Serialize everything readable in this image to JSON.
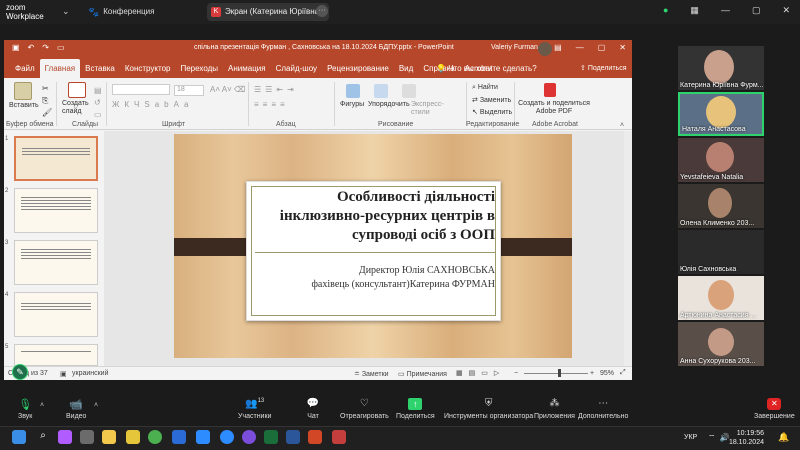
{
  "zoom": {
    "logo_line1": "zoom",
    "logo_line2": "Workplace",
    "tab_conference": "Конференция",
    "tab_screen": "Экран (Катерина Юріївна Фурм",
    "tab_screen_badge": "K",
    "ellipsis": "···"
  },
  "ppt": {
    "window_title": "спільна презентація Фурман , Сахновська на 18.10.2024 БДПУ.pptx  -  PowerPoint",
    "user": "Valeriy Furman",
    "tabs": [
      "Файл",
      "Главная",
      "Вставка",
      "Конструктор",
      "Переходы",
      "Анимация",
      "Слайд-шоу",
      "Рецензирование",
      "Вид",
      "Справка",
      "Acrobat"
    ],
    "active_tab": "Главная",
    "tell_me": "Что вы хотите сделать?",
    "share": "Поделиться",
    "ribbon": {
      "paste": "Вставить",
      "create_slide": "Создать слайд",
      "figures": "Фигуры",
      "arrange": "Упорядочить",
      "express_styles": "Экспресс-стили",
      "find": "Найти",
      "replace": "Заменить",
      "select": "Выделить",
      "create_share": "Создать и поделиться Adobe PDF",
      "font_size": "18",
      "group_clipboard": "Буфер обмена",
      "group_slides": "Слайды",
      "group_font": "Шрифт",
      "group_paragraph": "Абзац",
      "group_drawing": "Рисование",
      "group_editing": "Редактирование",
      "group_acrobat": "Adobe Acrobat"
    },
    "slide": {
      "title": "Особливості діяльності інклюзивно-ресурних центрів в супроводі осіб з ООП",
      "line1": "Директор  Юлія САХНОВСЬКА",
      "line2": "фахівець (консультант)Катерина ФУРМАН"
    },
    "thumb_numbers": [
      "1",
      "2",
      "3",
      "4",
      "5"
    ],
    "status": {
      "slide_count": "Слайд  из 37",
      "language": "украинский",
      "notes": "Заметки",
      "comments": "Примечания",
      "zoom": "95%"
    }
  },
  "participants": [
    {
      "name": "Катерина Юріївна Фурм..."
    },
    {
      "name": "Наталя Анастасова"
    },
    {
      "name": "Yevstafeieva Natalia"
    },
    {
      "name": "Олена Клименко 203..."
    },
    {
      "name": "Юлія Сахновська"
    },
    {
      "name": "Артюнина Анастасия ..."
    },
    {
      "name": "Анна Сухорукова 203..."
    }
  ],
  "controls": {
    "audio": "Звук",
    "video": "Видео",
    "participants": "Участники",
    "participants_count": "13",
    "chat": "Чат",
    "react": "Отреагировать",
    "share": "Поделиться",
    "host_tools": "Инструменты организатора",
    "apps": "Приложения",
    "more": "Дополнительно",
    "end": "Завершение"
  },
  "taskbar": {
    "lang": "УКР",
    "time": "10:19:56",
    "date": "18.10.2024"
  }
}
